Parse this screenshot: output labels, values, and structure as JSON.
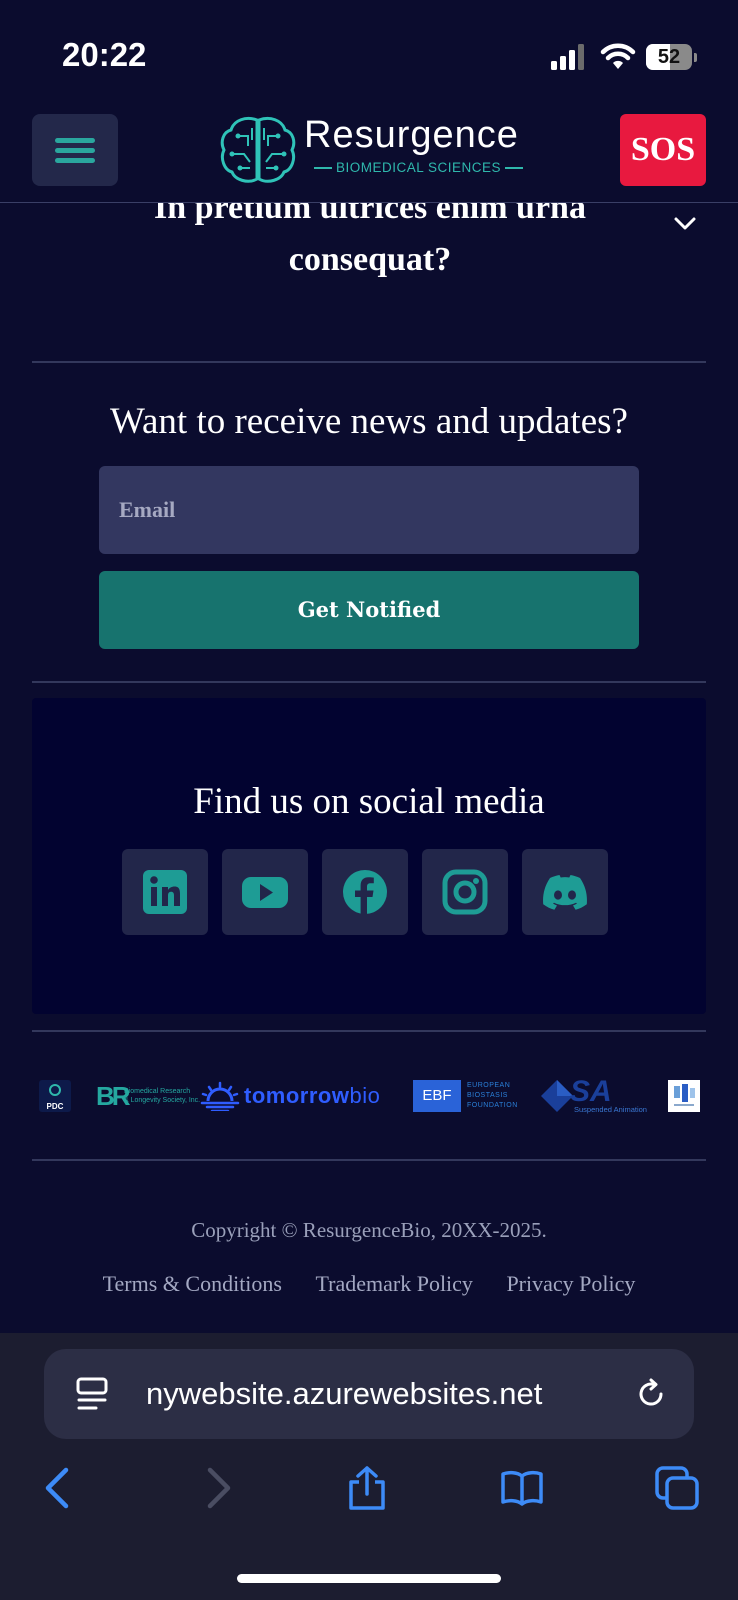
{
  "status_bar": {
    "time": "20:22",
    "battery_level": "52"
  },
  "header": {
    "brand_name": "Resurgence",
    "brand_subtitle": "BIOMEDICAL SCIENCES",
    "sos_label": "SOS"
  },
  "faq": {
    "question_partial_line1": "In pretium ultrices enim urna",
    "question_partial_line2": "consequat?"
  },
  "newsletter": {
    "title": "Want to receive news and updates?",
    "email_placeholder": "Email",
    "button_label": "Get Notified"
  },
  "social": {
    "title": "Find us on social media",
    "icons": [
      "linkedin-icon",
      "youtube-icon",
      "facebook-icon",
      "instagram-icon",
      "discord-icon"
    ]
  },
  "partners": {
    "pdc": "PDC",
    "brl_line1": "Biomedical Research",
    "brl_line2": "& Longevity Society, Inc.",
    "tomorrow_main": "tomorrow",
    "tomorrow_suffix": "bio",
    "ebf_abbr": "EBF",
    "ebf_line1": "EUROPEAN",
    "ebf_line2": "BIOSTASIS",
    "ebf_line3": "FOUNDATION",
    "sa_abbr": "SA",
    "sa_name": "Suspended Animation"
  },
  "footer": {
    "copyright": "Copyright © ResurgenceBio, 20XX-2025.",
    "links": [
      "Terms & Conditions",
      "Trademark Policy",
      "Privacy Policy"
    ]
  },
  "browser": {
    "url": "nywebsite.azurewebsites.net"
  },
  "colors": {
    "background": "#0b0c2e",
    "accent_teal": "#17736e",
    "sos_red": "#e8193f",
    "browser_blue": "#3d8bf7"
  }
}
